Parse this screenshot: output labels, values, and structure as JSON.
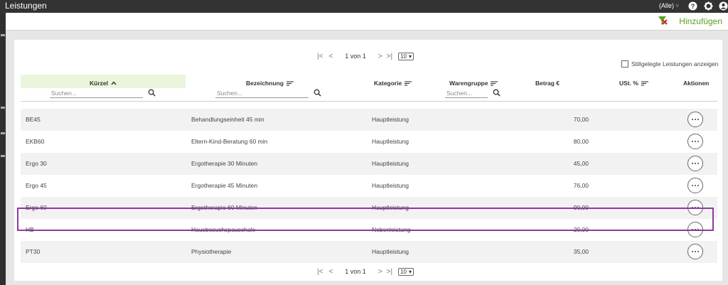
{
  "window": {
    "title": "Leistungen",
    "filter_label": "(Alle)"
  },
  "toolbar": {
    "add_label": "Hinzufügen"
  },
  "pager": {
    "page_text": "1 von 1",
    "page_size": "10"
  },
  "show_inactive_label": "Stillgelegte Leistungen anzeigen",
  "columns": {
    "kuerzel": "Kürzel",
    "bezeichnung": "Bezeichnung",
    "kategorie": "Kategorie",
    "warengruppe": "Warengruppe",
    "betrag": "Betrag €",
    "ust": "USt. %",
    "aktionen": "Aktionen"
  },
  "search_placeholder": "Suchen...",
  "rows": [
    {
      "kuerzel": "BE45",
      "bezeichnung": "Behandlungseinheit 45 min",
      "kategorie": "Hauptleistung",
      "betrag": "70,00"
    },
    {
      "kuerzel": "EKB60",
      "bezeichnung": "Eltern-Kind-Beratung 60 min",
      "kategorie": "Hauptleistung",
      "betrag": "80,00"
    },
    {
      "kuerzel": "Ergo 30",
      "bezeichnung": "Ergotherapie 30 Minuten",
      "kategorie": "Hauptleistung",
      "betrag": "45,00"
    },
    {
      "kuerzel": "Ergo 45",
      "bezeichnung": "Ergotherapie 45 Minuten",
      "kategorie": "Hauptleistung",
      "betrag": "76,00"
    },
    {
      "kuerzel": "Ergo 60",
      "bezeichnung": "Ergotherapie 60 Minuten",
      "kategorie": "Hauptleistung",
      "betrag": "90,00"
    },
    {
      "kuerzel": "HB",
      "bezeichnung": "Hausbesuchspauschale",
      "kategorie": "Nebenleistung",
      "betrag": "20,00"
    },
    {
      "kuerzel": "PT30",
      "bezeichnung": "Physiotherapie",
      "kategorie": "Hauptleistung",
      "betrag": "35,00"
    }
  ],
  "colors": {
    "accent": "#5aa01e",
    "highlight": "#8e3a9e",
    "titlebar": "#333333"
  },
  "icons": [
    "help-icon",
    "gear-icon",
    "user-icon",
    "clear-filter-icon",
    "search-icon",
    "sort-asc-icon",
    "sort-icon",
    "more-icon"
  ]
}
